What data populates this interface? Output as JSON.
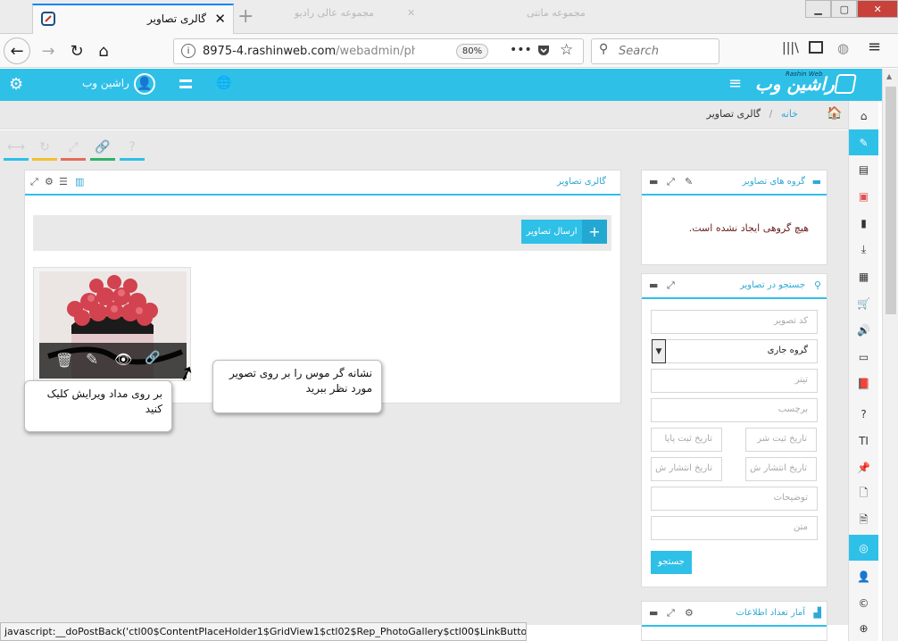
{
  "browser": {
    "tab_title": "گالری تصاویر",
    "ghost_tabs": [
      "مجموعه عالی رادیو",
      "مجموعه مانتی"
    ],
    "url_host": "8975-4.rashinweb.com",
    "url_path": "/webadmin/phot",
    "zoom": "80%",
    "search_placeholder": "Search"
  },
  "app": {
    "user_name": "راشین وب",
    "logo": "راشین وب",
    "logo_sub": "Rashin Web",
    "accent": "#2fc0e8"
  },
  "breadcrumb": {
    "home": "خانه",
    "sep": "/",
    "current": "گالری تصاویر"
  },
  "gallery": {
    "title": "گالری تصاویر",
    "upload_label": "ارسال تصاویر"
  },
  "groups": {
    "title": "گروه های تصاویر",
    "empty_msg": "هیچ گروهی ایجاد نشده است."
  },
  "search": {
    "title": "جستجو در تصاویر",
    "code_ph": "کد تصویر",
    "group_value": "گروه جاری",
    "title_ph": "تیتر",
    "tag_ph": "برچسب",
    "reg_from_ph": "تاریخ ثبت شر",
    "reg_to_ph": "تاریخ ثبت پایا",
    "pub_from_ph": "تاریخ انتشار ش",
    "pub_to_ph": "تاریخ انتشار ش",
    "desc_ph": "توضیحات",
    "text_ph": "متن",
    "submit": "جستجو"
  },
  "stats": {
    "title": "آمار تعداد اطلاعات"
  },
  "tips": {
    "hover": "نشانه گر موس را بر روی تصویر مورد نظر ببرید",
    "edit": "بر روی مداد ویرایش کلیک کنید"
  },
  "status_bar": "javascript:__doPostBack('ctl00$ContentPlaceHolder1$GridView1$ctl02$Rep_PhotoGallery$ctl00$LinkButton8','')"
}
